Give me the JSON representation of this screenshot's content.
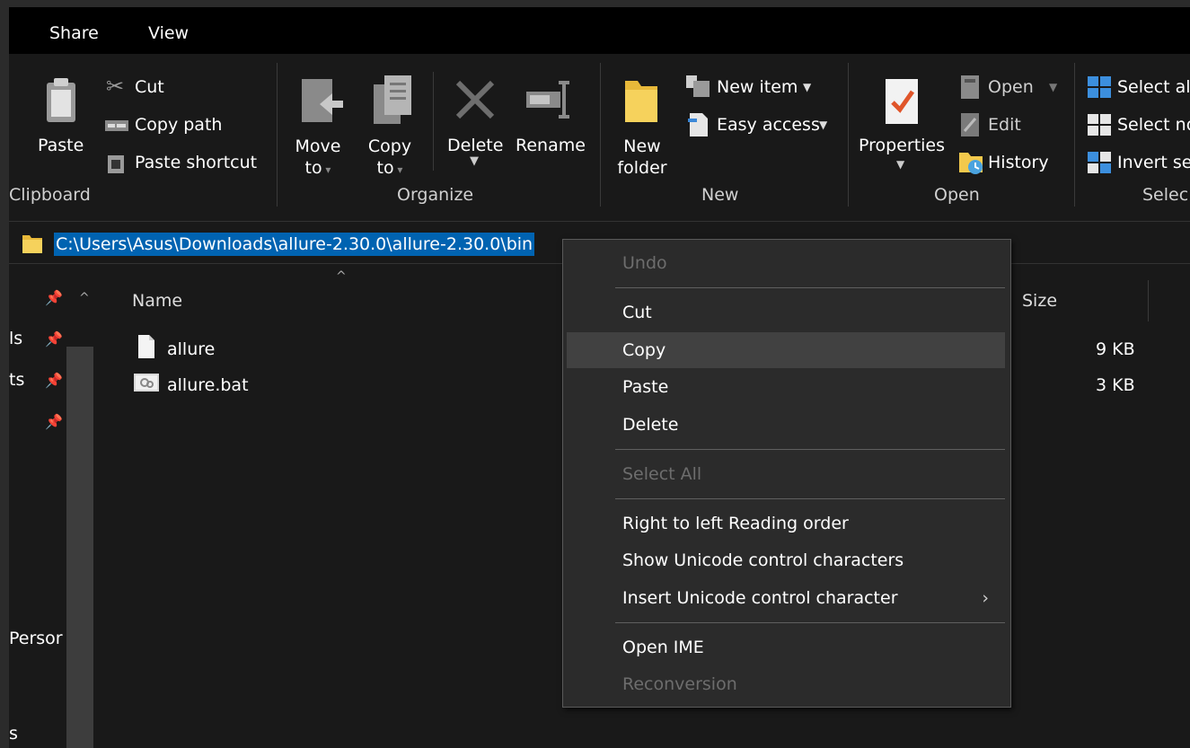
{
  "tabs": [
    "Share",
    "View"
  ],
  "ribbon": {
    "clipboard": {
      "label": "Clipboard",
      "paste": "Paste",
      "cut": "Cut",
      "copy_path": "Copy path",
      "paste_shortcut": "Paste shortcut"
    },
    "organize": {
      "label": "Organize",
      "move_to_1": "Move",
      "move_to_2": "to",
      "copy_to_1": "Copy",
      "copy_to_2": "to",
      "delete": "Delete",
      "rename": "Rename"
    },
    "new": {
      "label": "New",
      "new_folder_1": "New",
      "new_folder_2": "folder",
      "new_item": "New item",
      "easy_access": "Easy access"
    },
    "open": {
      "label": "Open",
      "properties": "Properties",
      "open": "Open",
      "edit": "Edit",
      "history": "History"
    },
    "select": {
      "label": "Selec",
      "select_all": "Select al",
      "select_none": "Select no",
      "invert": "Invert se"
    }
  },
  "address": {
    "path": "C:\\Users\\Asus\\Downloads\\allure-2.30.0\\allure-2.30.0\\bin"
  },
  "nav": {
    "items": [
      "ls",
      "ts",
      "Persor",
      "s"
    ]
  },
  "columns": {
    "name": "Name",
    "size": "Size"
  },
  "files": [
    {
      "name": "allure",
      "size": "9 KB"
    },
    {
      "name": "allure.bat",
      "size": "3 KB"
    }
  ],
  "context_menu": {
    "undo": "Undo",
    "cut": "Cut",
    "copy": "Copy",
    "paste": "Paste",
    "delete": "Delete",
    "select_all": "Select All",
    "rtl": "Right to left Reading order",
    "show_unicode": "Show Unicode control characters",
    "insert_unicode": "Insert Unicode control character",
    "open_ime": "Open IME",
    "reconversion": "Reconversion"
  },
  "colors": {
    "selection": "#0063b1",
    "menu_bg": "#2b2b2b",
    "window_bg": "#191919"
  }
}
